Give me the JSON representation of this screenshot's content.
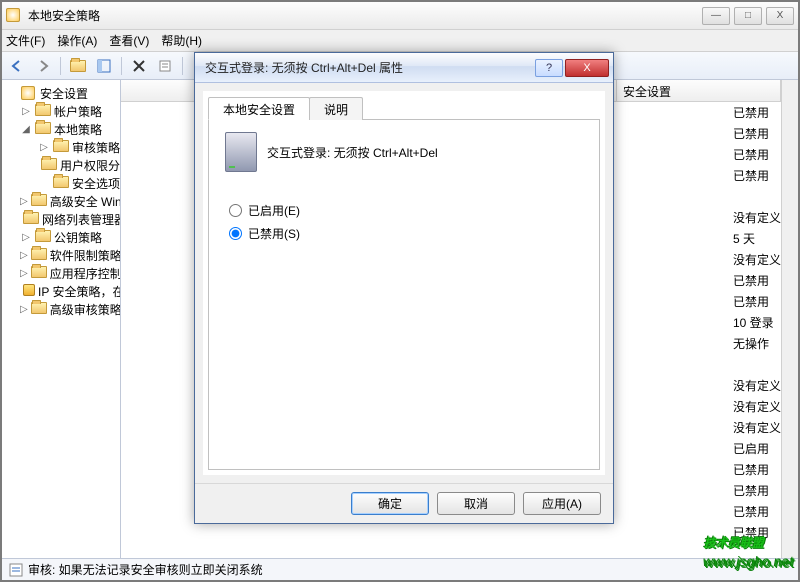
{
  "window": {
    "title": "本地安全策略",
    "min_tip": "—",
    "max_tip": "□",
    "close_tip": "X"
  },
  "menu": {
    "file": "文件(F)",
    "action": "操作(A)",
    "view": "查看(V)",
    "help": "帮助(H)"
  },
  "tree": {
    "root": "安全设置",
    "items": [
      {
        "label": "帐户策略",
        "indent": 1,
        "expander": "▷"
      },
      {
        "label": "本地策略",
        "indent": 1,
        "expander": "◢"
      },
      {
        "label": "审核策略",
        "indent": 2,
        "expander": "▷"
      },
      {
        "label": "用户权限分配",
        "indent": 2,
        "expander": ""
      },
      {
        "label": "安全选项",
        "indent": 2,
        "expander": ""
      },
      {
        "label": "高级安全 Windows 防火墙",
        "indent": 1,
        "expander": "▷"
      },
      {
        "label": "网络列表管理器策略",
        "indent": 1,
        "expander": ""
      },
      {
        "label": "公钥策略",
        "indent": 1,
        "expander": "▷"
      },
      {
        "label": "软件限制策略",
        "indent": 1,
        "expander": "▷"
      },
      {
        "label": "应用程序控制策略",
        "indent": 1,
        "expander": "▷"
      },
      {
        "label": "IP 安全策略，在 本地计算机",
        "indent": 1,
        "expander": ""
      },
      {
        "label": "高级审核策略配置",
        "indent": 1,
        "expander": "▷"
      }
    ]
  },
  "list": {
    "col1": "安全设置",
    "values": [
      "已禁用",
      "已禁用",
      "已禁用",
      "已禁用",
      "",
      "没有定义",
      "5 天",
      "没有定义",
      "已禁用",
      "已禁用",
      "10 登录",
      "无操作",
      "",
      "没有定义",
      "没有定义",
      "没有定义",
      "已启用",
      "已禁用",
      "已禁用",
      "已禁用",
      "已禁用"
    ]
  },
  "status": {
    "icon_label": "审核",
    "text": "审核: 如果无法记录安全审核则立即关闭系统"
  },
  "dialog": {
    "title": "交互式登录: 无须按 Ctrl+Alt+Del 属性",
    "tab1": "本地安全设置",
    "tab2": "说明",
    "policy_name": "交互式登录: 无须按 Ctrl+Alt+Del",
    "opt_enabled": "已启用(E)",
    "opt_disabled": "已禁用(S)",
    "btn_ok": "确定",
    "btn_cancel": "取消",
    "btn_apply": "应用(A)",
    "help": "?",
    "close": "X"
  },
  "watermark": {
    "text": "技术员联盟",
    "url": "www.jsgho.net"
  }
}
